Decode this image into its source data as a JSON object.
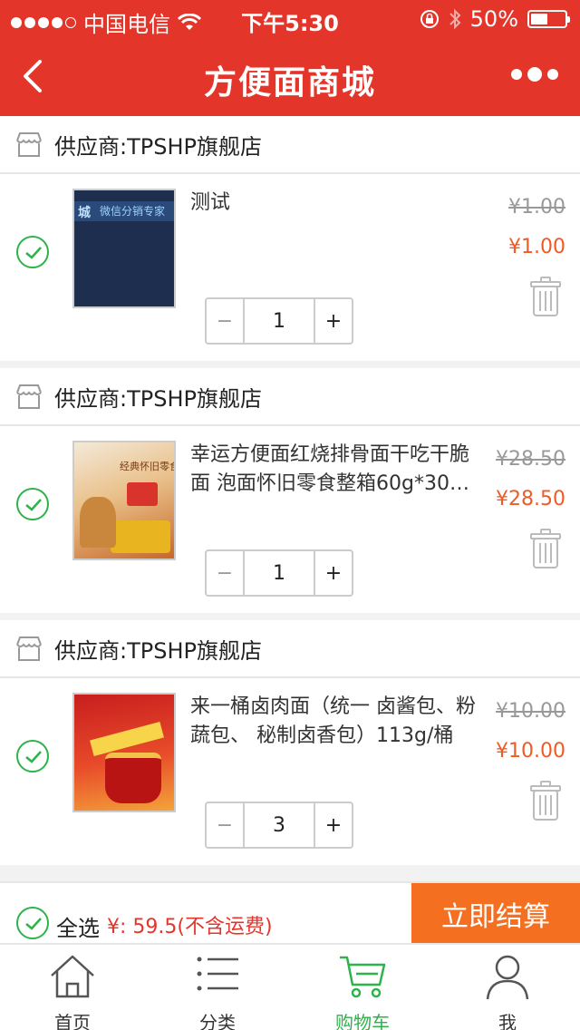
{
  "status_bar": {
    "carrier": "中国电信",
    "time": "下午5:30",
    "battery": "50%",
    "battery_level": 0.5
  },
  "header": {
    "title": "方便面商城",
    "back_icon": "chevron-left-icon",
    "more_icon": "more-dots-icon"
  },
  "stores": [
    {
      "name": "供应商:TPSHP旗舰店",
      "item": {
        "name": "测试",
        "thumb_text": "微信分销专家",
        "original_price": "¥1.00",
        "price": "¥1.00",
        "quantity": "1",
        "checked": true
      }
    },
    {
      "name": "供应商:TPSHP旗舰店",
      "item": {
        "name": "幸运方便面红烧排骨面干吃干脆面 泡面怀旧零食整箱60g*30…",
        "thumb_text": "经典怀旧零食",
        "original_price": "¥28.50",
        "price": "¥28.50",
        "quantity": "1",
        "checked": true
      }
    },
    {
      "name": "供应商:TPSHP旗舰店",
      "item": {
        "name": "来一桶卤肉面（统一 卤酱包、粉蔬包、 秘制卤香包）113g/桶",
        "thumb_text": "",
        "original_price": "¥10.00",
        "price": "¥10.00",
        "quantity": "3",
        "checked": true
      }
    }
  ],
  "stepper": {
    "minus": "−",
    "plus": "+"
  },
  "checkout": {
    "select_all": "全选",
    "total": "¥: 59.5(不含运费)",
    "pay_button": "立即结算"
  },
  "tabbar": [
    {
      "label": "首页",
      "icon": "home-icon",
      "active": false
    },
    {
      "label": "分类",
      "icon": "list-icon",
      "active": false
    },
    {
      "label": "购物车",
      "icon": "cart-icon",
      "active": true
    },
    {
      "label": "我",
      "icon": "user-icon",
      "active": false
    }
  ],
  "colors": {
    "brand_red": "#e4352b",
    "accent_orange": "#f56f21",
    "price_orange": "#f05a24",
    "check_green": "#2db34a"
  }
}
